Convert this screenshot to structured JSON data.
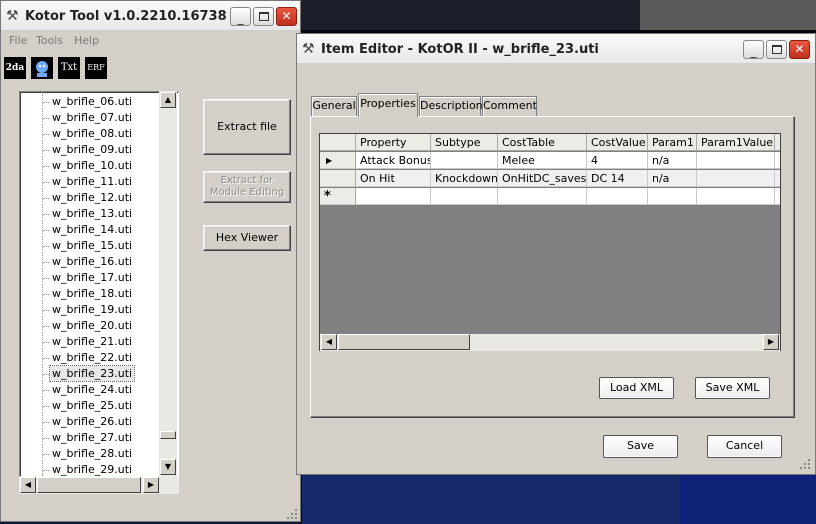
{
  "main_window": {
    "title": "Kotor Tool v1.0.2210.16738",
    "menu": [
      "File",
      "Tools",
      "Help"
    ],
    "toolbar_icons": [
      {
        "label": "2da",
        "icon": "2da-icon"
      },
      {
        "label": "",
        "icon": "head-icon"
      },
      {
        "label": "Txt",
        "icon": "txt-icon"
      },
      {
        "label": "ERF",
        "icon": "erf-icon"
      }
    ],
    "tree_items": [
      "w_brifle_06.uti",
      "w_brifle_07.uti",
      "w_brifle_08.uti",
      "w_brifle_09.uti",
      "w_brifle_10.uti",
      "w_brifle_11.uti",
      "w_brifle_12.uti",
      "w_brifle_13.uti",
      "w_brifle_14.uti",
      "w_brifle_15.uti",
      "w_brifle_16.uti",
      "w_brifle_17.uti",
      "w_brifle_18.uti",
      "w_brifle_19.uti",
      "w_brifle_20.uti",
      "w_brifle_21.uti",
      "w_brifle_22.uti",
      "w_brifle_23.uti",
      "w_brifle_24.uti",
      "w_brifle_25.uti",
      "w_brifle_26.uti",
      "w_brifle_27.uti",
      "w_brifle_28.uti",
      "w_brifle_29.uti"
    ],
    "selected_item": "w_brifle_23.uti",
    "buttons": {
      "extract_file": "Extract file",
      "extract_module_1": "Extract for",
      "extract_module_2": "Module Editing",
      "hex_viewer": "Hex Viewer"
    }
  },
  "item_editor": {
    "title": "Item Editor - KotOR II - w_brifle_23.uti",
    "tabs": [
      "General",
      "Properties",
      "Description",
      "Comment"
    ],
    "active_tab": "Properties",
    "columns": [
      "Property",
      "Subtype",
      "CostTable",
      "CostValue",
      "Param1",
      "Param1Value",
      "P"
    ],
    "rows": [
      [
        "Attack Bonus",
        "",
        "Melee",
        "4",
        "n/a",
        "",
        "n"
      ],
      [
        "On Hit",
        "Knockdown",
        "OnHitDC_saves",
        "DC 14",
        "n/a",
        "",
        "n"
      ]
    ],
    "new_row_marker": "*",
    "current_row_marker": "▶",
    "buttons": {
      "load_xml": "Load XML",
      "save_xml": "Save XML",
      "save": "Save",
      "cancel": "Cancel"
    }
  },
  "colors": {
    "face": "#d4d0c8",
    "close": "#c0301f",
    "desktop": "#162a6a"
  }
}
